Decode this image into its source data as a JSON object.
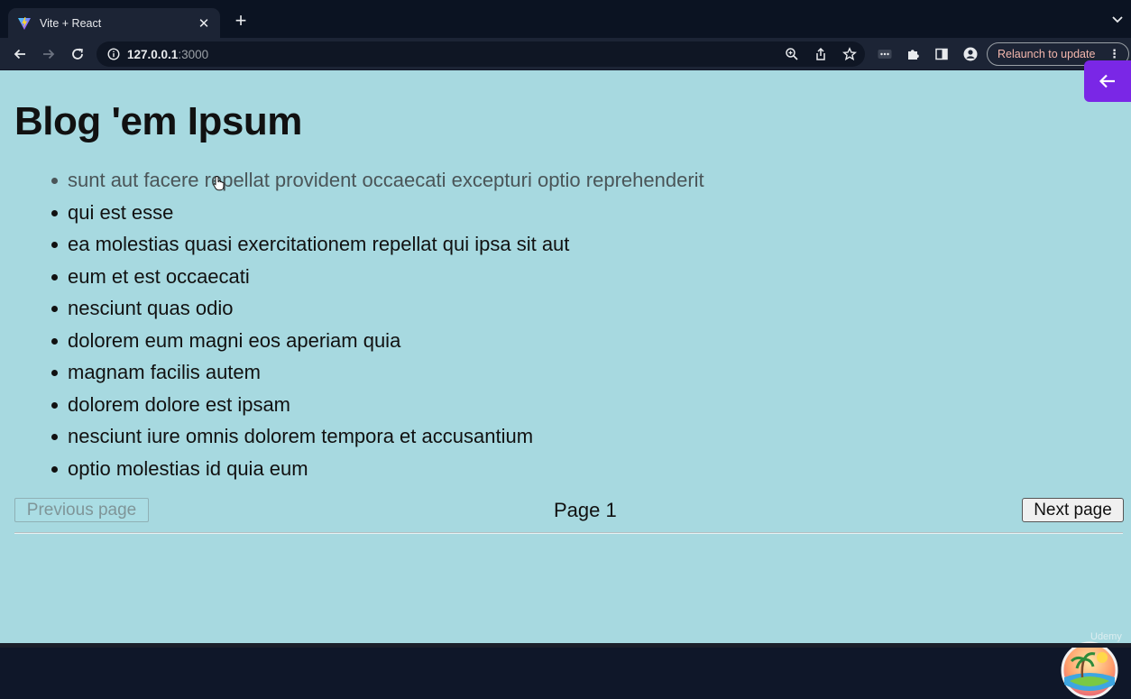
{
  "browser": {
    "tab": {
      "title": "Vite + React",
      "close_glyph": "✕"
    },
    "new_tab_glyph": "+",
    "address": {
      "host": "127.0.0.1",
      "port": ":3000"
    },
    "relaunch_label": "Relaunch to update",
    "relaunch_menu_glyph": "⋮",
    "icons": [
      "vite-favicon",
      "back-arrow",
      "forward-arrow",
      "reload",
      "info",
      "zoom",
      "share",
      "star",
      "extension-more",
      "puzzle",
      "side-panel",
      "profile",
      "tab-list-chevron"
    ]
  },
  "page": {
    "title": "Blog 'em Ipsum",
    "posts": [
      {
        "title": "sunt aut facere repellat provident occaecati excepturi optio reprehenderit"
      },
      {
        "title": "qui est esse"
      },
      {
        "title": "ea molestias quasi exercitationem repellat qui ipsa sit aut"
      },
      {
        "title": "eum et est occaecati"
      },
      {
        "title": "nesciunt quas odio"
      },
      {
        "title": "dolorem eum magni eos aperiam quia"
      },
      {
        "title": "magnam facilis autem"
      },
      {
        "title": "dolorem dolore est ipsam"
      },
      {
        "title": "nesciunt iure omnis dolorem tempora et accusantium"
      },
      {
        "title": "optio molestias id quia eum"
      }
    ],
    "pagination": {
      "previous_label": "Previous page",
      "previous_disabled": true,
      "page_label": "Page 1",
      "next_label": "Next page"
    }
  },
  "overlay": {
    "watermark": "Udemy",
    "back_icon": "arrow-left-icon"
  },
  "colors": {
    "page_background": "#a7d9e0",
    "browser_chrome": "#1c2435",
    "tabstrip": "#0b1322",
    "overlay_accent": "#7a27e6",
    "relaunch_text": "#f4b7ad"
  }
}
